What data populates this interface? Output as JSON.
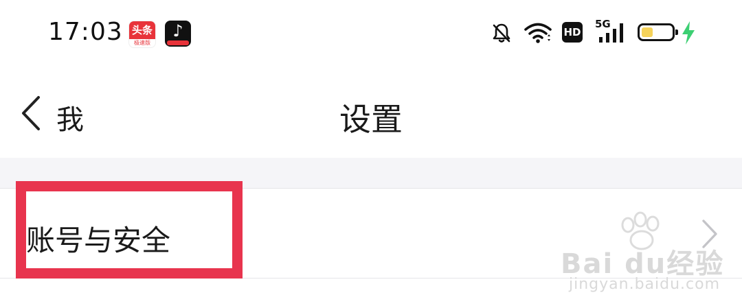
{
  "status_bar": {
    "time": "17:03",
    "apps": [
      {
        "name": "toutiao-app-icon",
        "label": "头条",
        "sub": "极速版"
      },
      {
        "name": "douyin-app-icon",
        "label": "♪"
      }
    ],
    "indicators": {
      "notifications": "muted",
      "wifi": "connected",
      "hd_label": "HD",
      "network_label": "5G",
      "battery": "charging-low"
    }
  },
  "nav": {
    "back_label": "我",
    "title": "设置"
  },
  "list": {
    "items": [
      {
        "label": "账号与安全"
      }
    ]
  },
  "watermark": {
    "brand": "Bai du经验",
    "url": "jingyan.baidu.com"
  },
  "colors": {
    "highlight": "#e8344e",
    "section_bg": "#f5f5f8",
    "charging": "#3ccf72",
    "battery_fill": "#f6d35a"
  }
}
